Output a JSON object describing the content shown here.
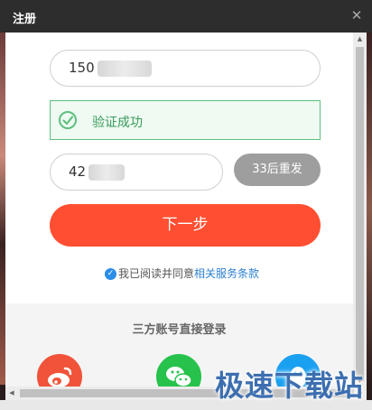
{
  "window": {
    "title": "注册",
    "close_label": "✕"
  },
  "form": {
    "phone_value": "150",
    "verify_text": "验证成功",
    "code_value": "42",
    "resend_label": "33后重发",
    "next_label": "下一步",
    "agree_text": "我已阅读并同意",
    "terms_link": "相关服务条款"
  },
  "third_party": {
    "title": "三方账号直接登录",
    "providers": [
      "weibo-icon",
      "wechat-icon",
      "qq-icon"
    ]
  },
  "watermark": "极速下载站",
  "colors": {
    "accent": "#ff4e31",
    "success": "#3a9a5a",
    "link": "#2b7fd0",
    "resend": "#9e9e9e"
  }
}
